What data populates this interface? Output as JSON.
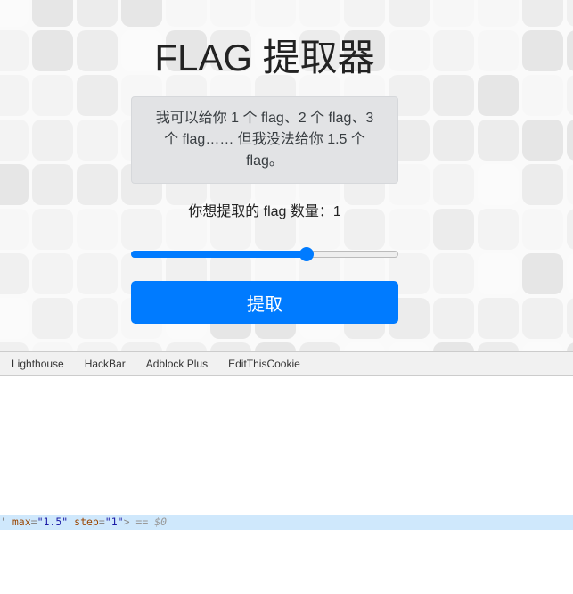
{
  "page": {
    "title": "FLAG 提取器",
    "notice": "我可以给你 1 个 flag、2 个 flag、3 个 flag…… 但我没法给你 1.5 个 flag。",
    "count_label": "你想提取的 flag 数量：",
    "count_value": "1",
    "slider": {
      "min": 0,
      "max": 1.5,
      "value": 1,
      "fraction": 0.667
    },
    "submit_label": "提取",
    "accent": "#007bff"
  },
  "devtools": {
    "tabs": [
      "Lighthouse",
      "HackBar",
      "Adblock Plus",
      "EditThisCookie"
    ],
    "code": {
      "prefix": "' ",
      "max_attr": "max",
      "max_val": "\"1.5\"",
      "step_attr": "step",
      "step_val": "\"1\"",
      "close": ">",
      "ref": " == $0"
    }
  }
}
